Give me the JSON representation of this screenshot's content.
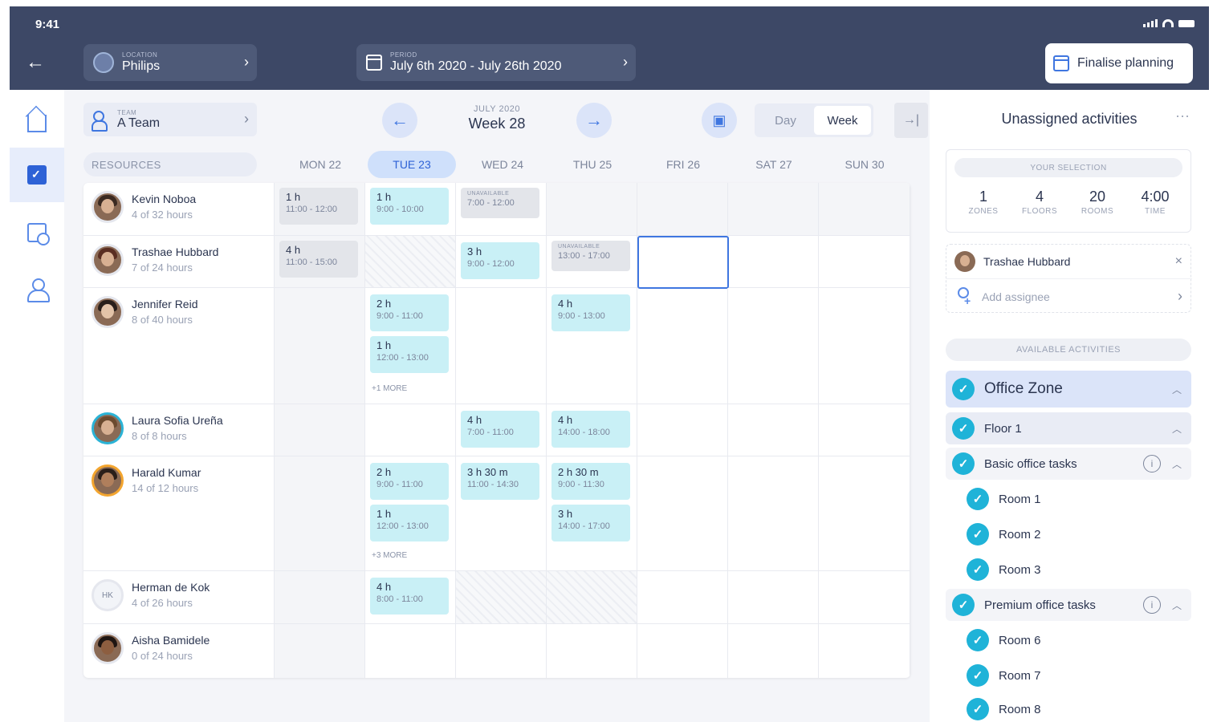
{
  "status_bar": {
    "time": "9:41"
  },
  "header": {
    "location": {
      "label": "LOCATION",
      "value": "Philips"
    },
    "period": {
      "label": "PERIOD",
      "value": "July 6th 2020 - July 26th 2020"
    },
    "finalise_label": "Finalise planning"
  },
  "toolbar": {
    "team": {
      "label": "TEAM",
      "value": "A Team"
    },
    "week_sub": "JULY 2020",
    "week_main": "Week 28",
    "view_day": "Day",
    "view_week": "Week"
  },
  "grid": {
    "resources_label": "RESOURCES",
    "days": [
      "MON 22",
      "TUE 23",
      "WED 24",
      "THU 25",
      "FRI 26",
      "SAT 27",
      "SUN 30"
    ],
    "today_index": 1,
    "rows": [
      {
        "name": "Kevin Noboa",
        "hours": "4 of 32 hours"
      },
      {
        "name": "Trashae Hubbard",
        "hours": "7 of 24 hours"
      },
      {
        "name": "Jennifer Reid",
        "hours": "8 of 40 hours"
      },
      {
        "name": "Laura Sofia Ureña",
        "hours": "8 of 8 hours"
      },
      {
        "name": "Harald Kumar",
        "hours": "14 of 12 hours"
      },
      {
        "name": "Herman de Kok",
        "hours": "4 of 26 hours",
        "initials": "HK"
      },
      {
        "name": "Aisha Bamidele",
        "hours": "0 of 24 hours"
      }
    ],
    "unavailable_label": "UNAVAILABLE",
    "blocks": {
      "r0_mon": {
        "dur": "1 h",
        "time": "11:00 - 12:00"
      },
      "r0_tue": {
        "dur": "1 h",
        "time": "9:00 - 10:00"
      },
      "r0_wed": {
        "time": "7:00 - 12:00"
      },
      "r1_mon": {
        "dur": "4 h",
        "time": "11:00 - 15:00"
      },
      "r1_wed": {
        "dur": "3 h",
        "time": "9:00 - 12:00"
      },
      "r1_thu": {
        "time": "13:00 - 17:00"
      },
      "r2_tue_a": {
        "dur": "2 h",
        "time": "9:00 - 11:00"
      },
      "r2_tue_b": {
        "dur": "1 h",
        "time": "12:00 - 13:00"
      },
      "r2_thu": {
        "dur": "4 h",
        "time": "9:00 - 13:00"
      },
      "r3_wed": {
        "dur": "4 h",
        "time": "7:00 - 11:00"
      },
      "r3_thu": {
        "dur": "4 h",
        "time": "14:00 - 18:00"
      },
      "r4_tue_a": {
        "dur": "2 h",
        "time": "9:00 - 11:00"
      },
      "r4_tue_b": {
        "dur": "1 h",
        "time": "12:00 - 13:00"
      },
      "r4_wed": {
        "dur": "3 h 30 m",
        "time": "11:00 - 14:30"
      },
      "r4_thu_a": {
        "dur": "2 h 30 m",
        "time": "9:00 - 11:30"
      },
      "r4_thu_b": {
        "dur": "3 h",
        "time": "14:00 - 17:00"
      },
      "r5_tue": {
        "dur": "4 h",
        "time": "8:00 - 11:00"
      }
    },
    "more_r2": "+1 MORE",
    "more_r4": "+3 MORE"
  },
  "panel": {
    "title": "Unassigned activities",
    "your_selection": "YOUR SELECTION",
    "stats": [
      {
        "n": "1",
        "l": "ZONES"
      },
      {
        "n": "4",
        "l": "FLOORS"
      },
      {
        "n": "20",
        "l": "ROOMS"
      },
      {
        "n": "4:00",
        "l": "TIME"
      }
    ],
    "assignee": "Trashae Hubbard",
    "add_assignee": "Add assignee",
    "available_label": "AVAILABLE ACTIVITIES",
    "activities": [
      "Office Zone",
      "Floor 1",
      "Basic office tasks",
      "Room 1",
      "Room 2",
      "Room 3",
      "Premium office tasks",
      "Room 6",
      "Room 7",
      "Room 8"
    ]
  },
  "colors": {
    "header_bg": "#3d4866",
    "accent": "#3f76e0",
    "activity_teal": "#c9f0f6",
    "check": "#1fb3d8"
  }
}
